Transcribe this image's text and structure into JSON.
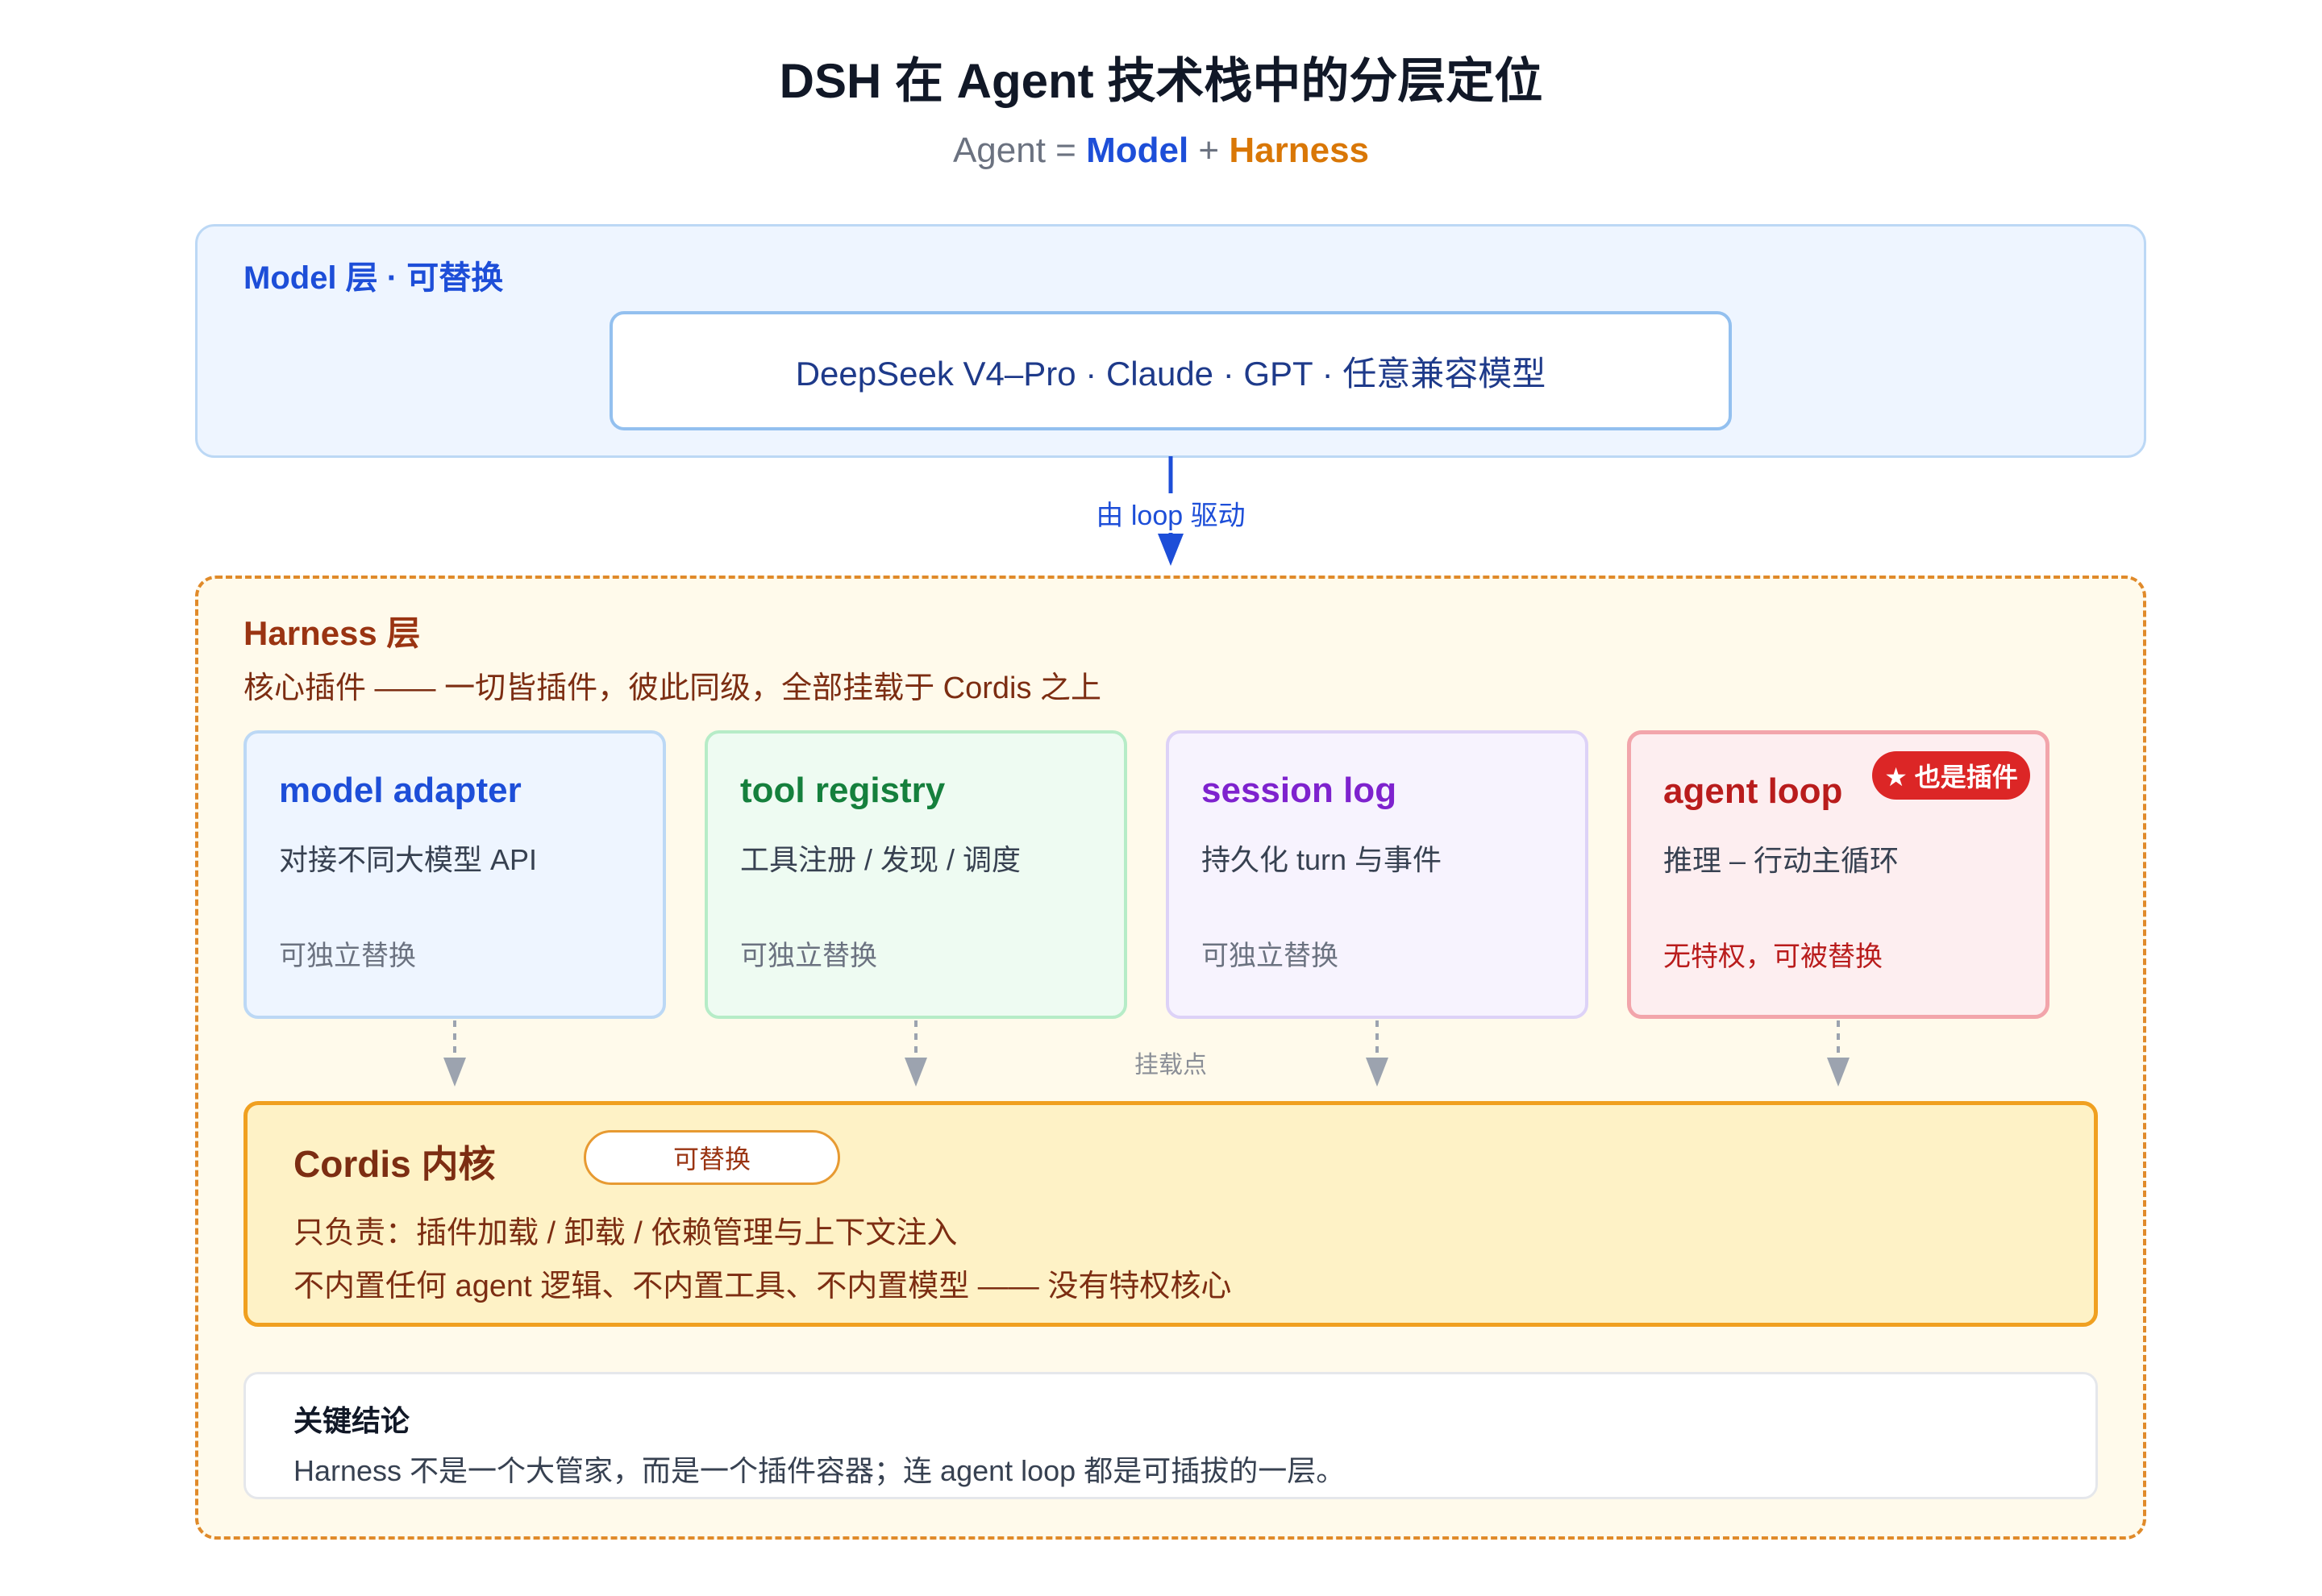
{
  "title": "DSH 在 Agent 技术栈中的分层定位",
  "subtitle": {
    "prefix": "Agent = ",
    "model": "Model",
    "plus": " + ",
    "harness": "Harness"
  },
  "model_layer": {
    "title": "Model 层 · 可替换",
    "models": "DeepSeek V4–Pro · Claude · GPT · 任意兼容模型"
  },
  "arrow_label": "由 loop 驱动",
  "harness_layer": {
    "title": "Harness 层",
    "description": "核心插件 —— 一切皆插件，彼此同级，全部挂载于 Cordis 之上",
    "plugins": [
      {
        "title": "model adapter",
        "desc": "对接不同大模型 API",
        "note": "可独立替换"
      },
      {
        "title": "tool registry",
        "desc": "工具注册 / 发现 / 调度",
        "note": "可独立替换"
      },
      {
        "title": "session log",
        "desc": "持久化 turn 与事件",
        "note": "可独立替换"
      },
      {
        "title": "agent loop",
        "desc": "推理 – 行动主循环",
        "note": "无特权，可被替换",
        "badge": "★ 也是插件"
      }
    ],
    "mount_label": "挂载点"
  },
  "cordis": {
    "title": "Cordis 内核",
    "tag": "可替换",
    "line1": "只负责：插件加载 / 卸载 / 依赖管理与上下文注入",
    "line2": "不内置任何 agent 逻辑、不内置工具、不内置模型 —— 没有特权核心"
  },
  "conclusion": {
    "title": "关键结论",
    "text": "Harness 不是一个大管家，而是一个插件容器；连 agent loop 都是可插拔的一层。"
  },
  "colors": {
    "model": "#1d4ed8",
    "harness": "#d97706",
    "alert": "#dc2626"
  }
}
